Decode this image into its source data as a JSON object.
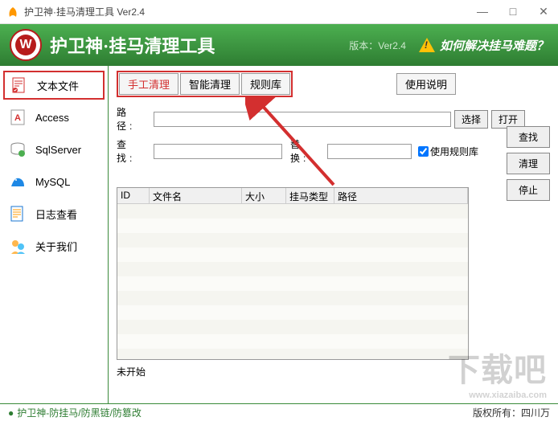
{
  "window": {
    "title": "护卫神·挂马清理工具 Ver2.4",
    "minimize": "—",
    "maximize": "□",
    "close": "✕"
  },
  "header": {
    "shield_letter": "W",
    "app_title": "护卫神·挂马清理工具",
    "version": "版本：Ver2.4",
    "warning_text": "如何解决挂马难题？"
  },
  "sidebar": [
    {
      "label": "文本文件"
    },
    {
      "label": "Access"
    },
    {
      "label": "SqlServer"
    },
    {
      "label": "MySQL"
    },
    {
      "label": "日志查看"
    },
    {
      "label": "关于我们"
    }
  ],
  "tabs": {
    "manual": "手工清理",
    "smart": "智能清理",
    "rules": "规则库",
    "help": "使用说明"
  },
  "form": {
    "path_label": "路 径:",
    "path_value": "",
    "select_btn": "选择",
    "open_btn": "打开",
    "find_label": "查 找:",
    "find_value": "",
    "replace_label": "替 换:",
    "replace_value": "",
    "use_rules": "使用规则库",
    "search_btn": "查找",
    "clean_btn": "清理",
    "stop_btn": "停止"
  },
  "table": {
    "col_id": "ID",
    "col_name": "文件名",
    "col_size": "大小",
    "col_type": "挂马类型",
    "col_path": "路径"
  },
  "status": "未开始",
  "footer": {
    "link": "护卫神-防挂马/防黑链/防篡改",
    "copyright": "版权所有：四川万"
  },
  "watermark": {
    "big": "下载吧",
    "small": "www.xiazaiba.com"
  }
}
